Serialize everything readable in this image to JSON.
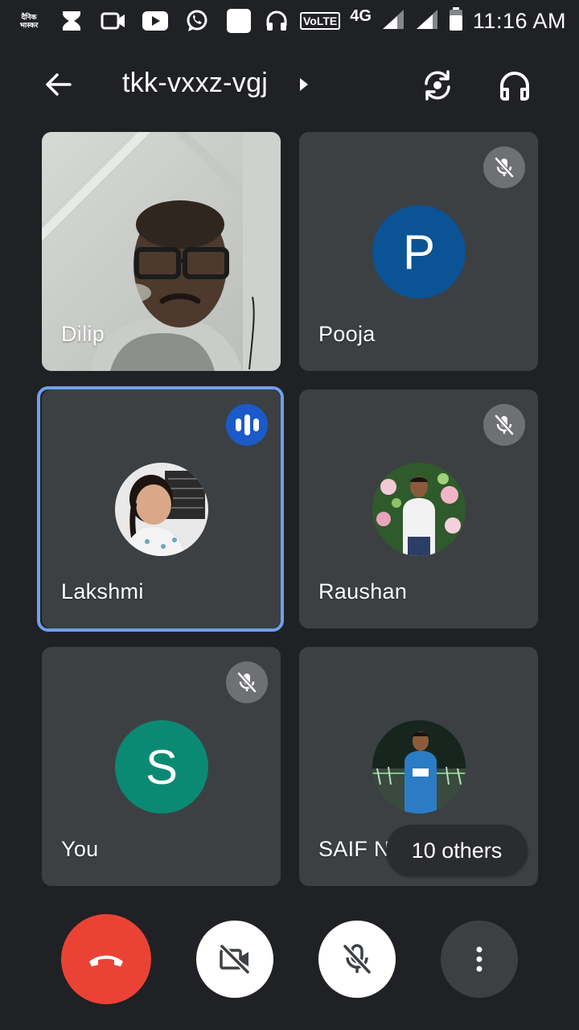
{
  "status_bar": {
    "brand_line1": "दैनिक",
    "brand_line2": "भास्कर",
    "volte": "VoLTE",
    "network": "4G",
    "time": "11:16 AM"
  },
  "meeting": {
    "code": "tkk-vxxz-vgj"
  },
  "participants": [
    {
      "name": "Dilip",
      "video": true
    },
    {
      "name": "Pooja",
      "initial": "P",
      "avatar_color": "#0b5394",
      "muted": true
    },
    {
      "name": "Lakshmi",
      "speaking": true
    },
    {
      "name": "Raushan",
      "muted": true
    },
    {
      "name": "You",
      "initial": "S",
      "avatar_color": "#0b8a73",
      "muted": true
    },
    {
      "name": "SAIF NADEEM"
    }
  ],
  "others_label": "10 others",
  "colors": {
    "background": "#202124",
    "tile": "#3c4043",
    "speaking_border": "#6ea0ef",
    "speaking_badge": "#1a5ac9",
    "end_call": "#ea4335"
  },
  "icons": {
    "back": "arrow-left",
    "switch_camera": "camera-flip",
    "audio": "headphones",
    "end_call": "phone-hangup",
    "camera": "video-off",
    "mic": "mic-off",
    "more": "more-vertical"
  }
}
